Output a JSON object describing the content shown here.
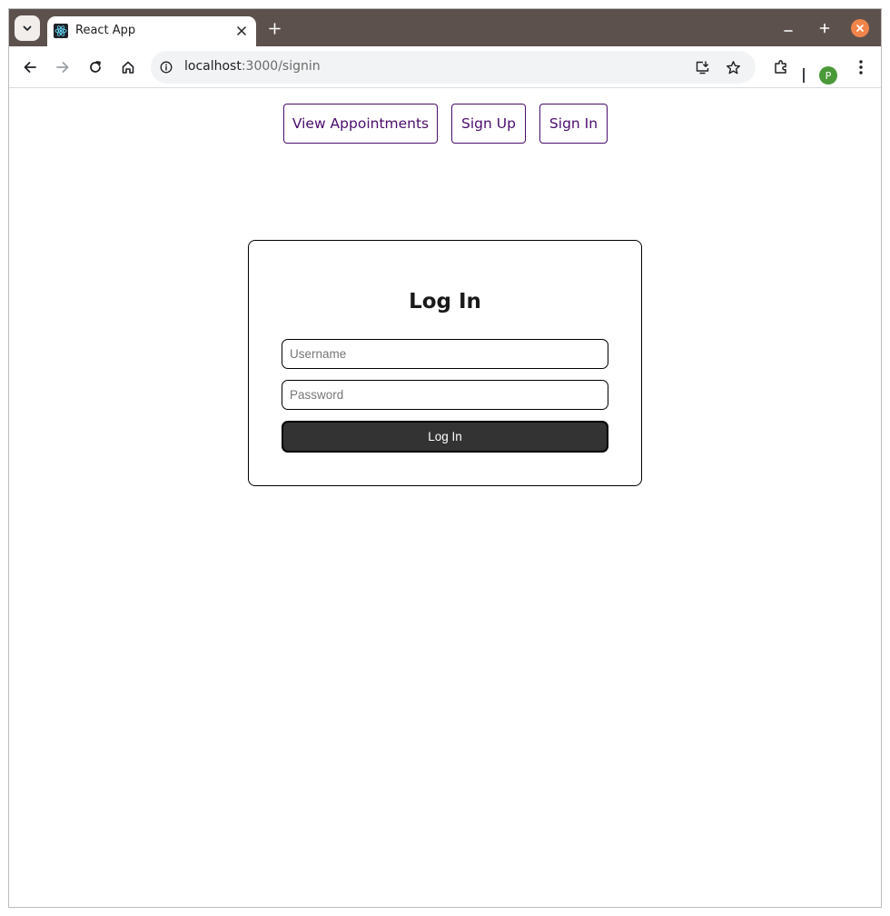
{
  "browser": {
    "tab": {
      "title": "React App",
      "favicon": "react-logo-icon"
    },
    "url": {
      "host": "localhost",
      "rest": ":3000/signin"
    },
    "profile_initial": "P",
    "colors": {
      "tabstrip": "#5d514d",
      "close_button": "#f0844a",
      "avatar": "#4b9a3a"
    }
  },
  "nav": {
    "view_appointments": "View Appointments",
    "sign_up": "Sign Up",
    "sign_in": "Sign In",
    "accent": "#4a0d6e"
  },
  "login": {
    "title": "Log In",
    "username_placeholder": "Username",
    "password_placeholder": "Password",
    "submit_label": "Log In"
  }
}
